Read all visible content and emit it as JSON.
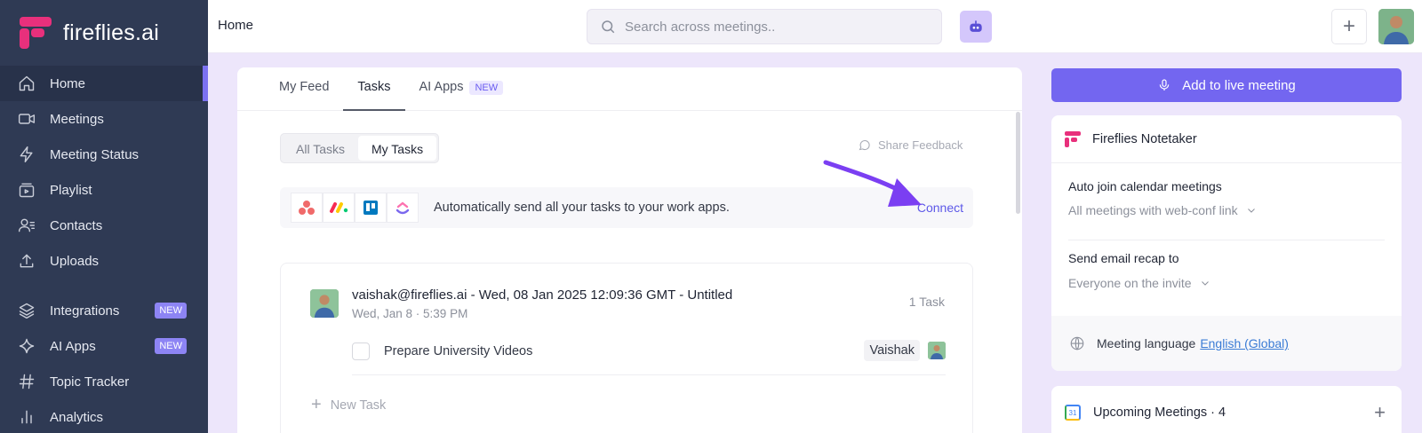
{
  "brand": {
    "name": "fireflies.ai",
    "accent": "#e8307c"
  },
  "sidebar": {
    "items": [
      {
        "label": "Home",
        "icon": "home-icon",
        "active": true
      },
      {
        "label": "Meetings",
        "icon": "video-icon"
      },
      {
        "label": "Meeting Status",
        "icon": "bolt-icon"
      },
      {
        "label": "Playlist",
        "icon": "playlist-icon"
      },
      {
        "label": "Contacts",
        "icon": "contacts-icon"
      },
      {
        "label": "Uploads",
        "icon": "upload-icon"
      }
    ],
    "items2": [
      {
        "label": "Integrations",
        "icon": "layers-icon",
        "badge": "NEW"
      },
      {
        "label": "AI Apps",
        "icon": "sparkle-icon",
        "badge": "NEW"
      },
      {
        "label": "Topic Tracker",
        "icon": "hash-icon"
      },
      {
        "label": "Analytics",
        "icon": "analytics-icon"
      }
    ]
  },
  "header": {
    "title": "Home",
    "search_placeholder": "Search across meetings..",
    "add_label": "+"
  },
  "tabs": [
    {
      "label": "My Feed"
    },
    {
      "label": "Tasks",
      "active": true
    },
    {
      "label": "AI Apps",
      "badge": "NEW"
    }
  ],
  "task_filter": {
    "all": "All Tasks",
    "mine": "My Tasks",
    "selected": "My Tasks"
  },
  "share_feedback": "Share Feedback",
  "integrations_bar": {
    "text": "Automatically send all your tasks to your work apps.",
    "connect": "Connect",
    "apps": [
      "asana-icon",
      "monday-icon",
      "trello-icon",
      "clickup-icon"
    ]
  },
  "meeting": {
    "title": "vaishak@fireflies.ai - Wed, 08 Jan 2025 12:09:36 GMT - Untitled",
    "subtitle": "Wed, Jan 8 · 5:39 PM",
    "count": "1 Task",
    "tasks": [
      {
        "name": "Prepare University Videos",
        "assignee": "Vaishak",
        "done": false
      }
    ],
    "new_task": "New Task"
  },
  "right": {
    "live_button": "Add to live meeting",
    "notetaker": {
      "title": "Fireflies Notetaker",
      "auto_join_label": "Auto join calendar meetings",
      "auto_join_value": "All meetings with web-conf link",
      "recap_label": "Send email recap to",
      "recap_value": "Everyone on the invite",
      "language_label": "Meeting language",
      "language_value": "English (Global)"
    },
    "upcoming": {
      "title": "Upcoming Meetings · 4",
      "add": "+"
    }
  }
}
